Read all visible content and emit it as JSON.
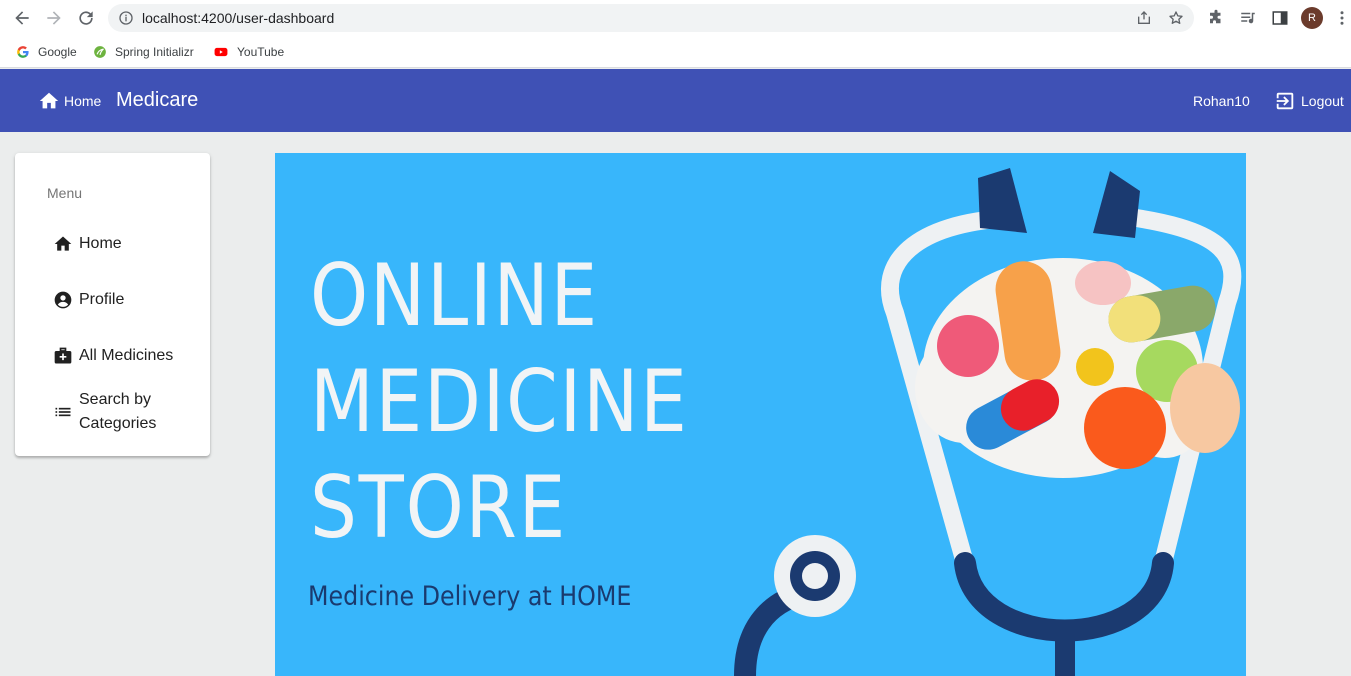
{
  "browser": {
    "url": "localhost:4200/user-dashboard",
    "avatar_letter": "R",
    "bookmarks": [
      {
        "label": "Google",
        "icon": "google-icon"
      },
      {
        "label": "Spring Initializr",
        "icon": "spring-icon"
      },
      {
        "label": "YouTube",
        "icon": "youtube-icon"
      }
    ]
  },
  "header": {
    "home_label": "Home",
    "brand": "Medicare",
    "username": "Rohan10",
    "logout_label": "Logout",
    "color": "#3f51b5"
  },
  "sidebar": {
    "title": "Menu",
    "items": [
      {
        "label": "Home",
        "icon": "home-icon"
      },
      {
        "label": "Profile",
        "icon": "account-circle-icon"
      },
      {
        "label": "All Medicines",
        "icon": "medical-bag-icon"
      },
      {
        "label_line1": "Search by",
        "label_line2": "Categories",
        "icon": "list-icon"
      }
    ]
  },
  "banner": {
    "line1": "ONLINE",
    "line2": "MEDICINE",
    "line3": "STORE",
    "subtitle": "Medicine Delivery at HOME",
    "background": "#38b6fb"
  }
}
